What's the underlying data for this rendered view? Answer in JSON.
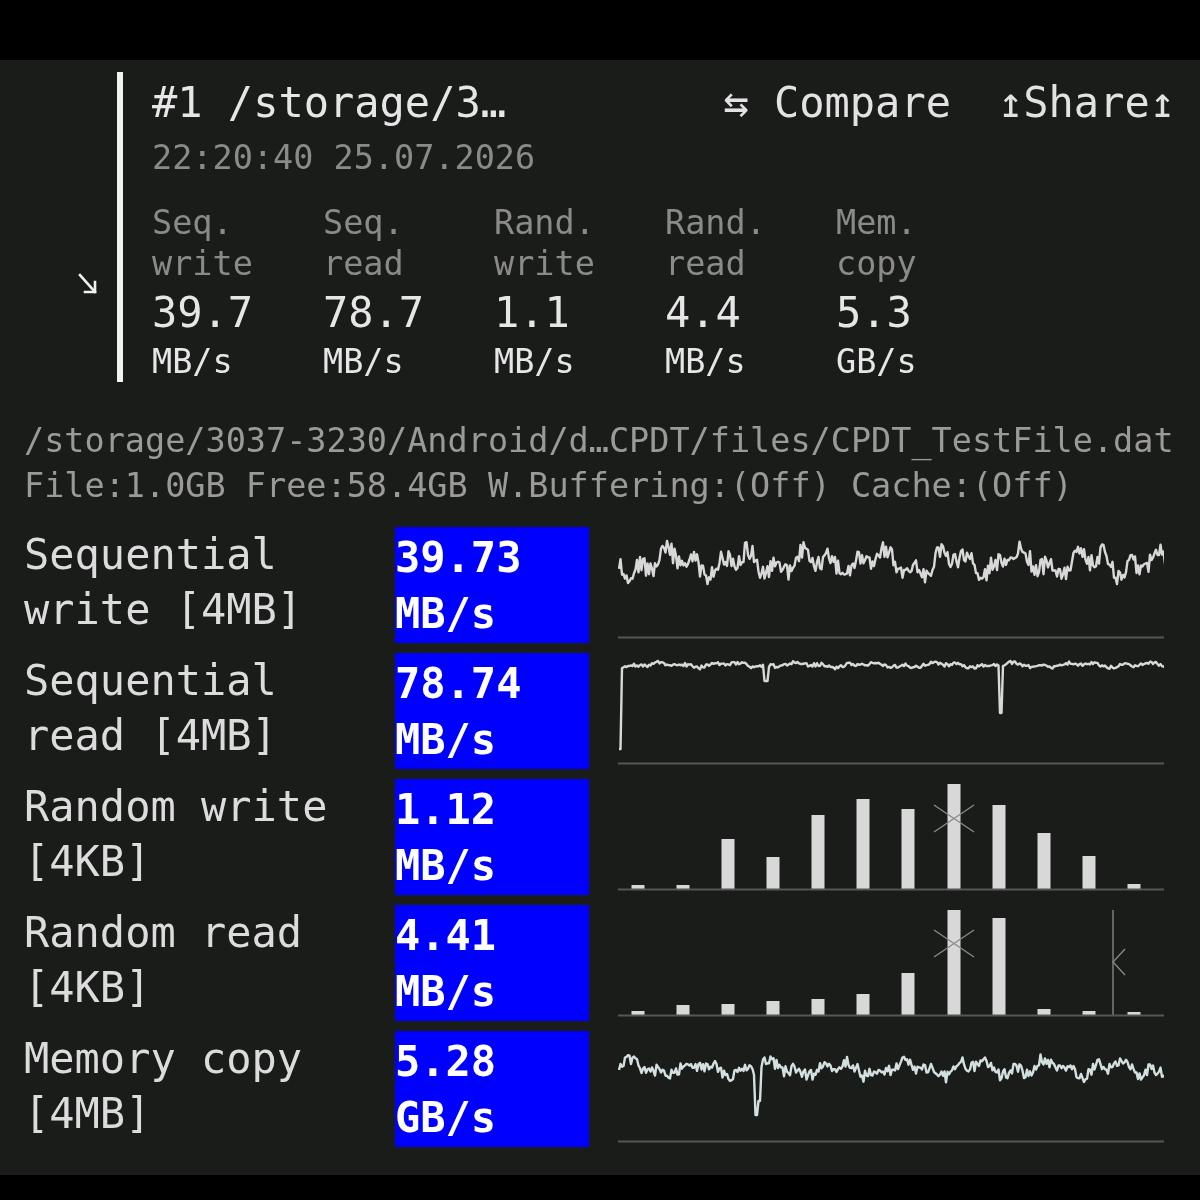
{
  "header": {
    "title": "#1 /storage/3…",
    "timestamp": "22:20:40 25.07.2026",
    "compare_button": "⇆ Compare",
    "share_button": "↥Share↥",
    "summary": [
      {
        "label": "Seq. write",
        "value": "39.7",
        "unit": "MB/s"
      },
      {
        "label": "Seq. read",
        "value": "78.7",
        "unit": "MB/s"
      },
      {
        "label": "Rand. write",
        "value": "1.1",
        "unit": "MB/s"
      },
      {
        "label": "Rand. read",
        "value": "4.4",
        "unit": "MB/s"
      },
      {
        "label": "Mem. copy",
        "value": "5.3",
        "unit": "GB/s"
      }
    ]
  },
  "file_info": {
    "path": "/storage/3037-3230/Android/d…CPDT/files/CPDT_TestFile.dat",
    "details": "File:1.0GB Free:58.4GB W.Buffering:(Off) Cache:(Off)"
  },
  "results": [
    {
      "label": "Sequential write [4MB]",
      "value": "39.73 MB/s",
      "kind": "wave"
    },
    {
      "label": "Sequential read [4MB]",
      "value": "78.74 MB/s",
      "kind": "wave"
    },
    {
      "label": "Random write [4KB]",
      "value": "1.12 MB/s",
      "kind": "bars"
    },
    {
      "label": "Random read [4KB]",
      "value": "4.41 MB/s",
      "kind": "bars"
    },
    {
      "label": "Memory copy [4MB]",
      "value": "5.28 GB/s",
      "kind": "wave"
    }
  ]
}
